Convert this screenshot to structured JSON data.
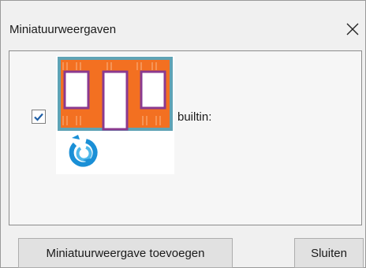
{
  "window": {
    "title": "Miniatuurweergaven",
    "close_icon": "close-icon"
  },
  "list": {
    "items": [
      {
        "checked": true,
        "label": "builtin:",
        "thumbnail_icon": "wall-frame-thumbnail"
      }
    ]
  },
  "buttons": {
    "add_label": "Miniatuurweergave toevoegen",
    "close_label": "Sluiten"
  },
  "colors": {
    "checkmark": "#1f5fa6",
    "stud_orange": "#f37021",
    "frame_purple": "#8b3a8f",
    "plate_teal": "#5fa3b5",
    "logo_blue": "#1a8fd6"
  }
}
